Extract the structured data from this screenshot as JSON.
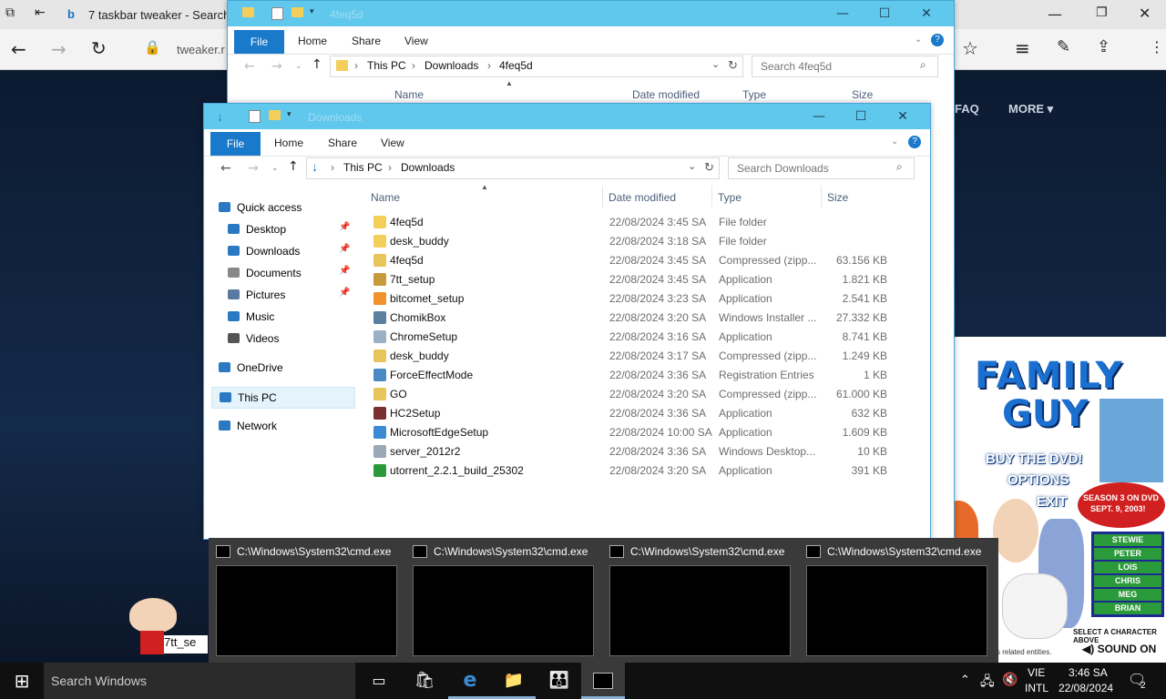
{
  "browser": {
    "tab_title": "7 taskbar tweaker - Search",
    "address": "tweaker.r",
    "site_nav": [
      "FAQ",
      "MORE ▾"
    ]
  },
  "explorer_back": {
    "title": "4feq5d",
    "ribbon_tabs": [
      "File",
      "Home",
      "Share",
      "View"
    ],
    "path": [
      "This PC",
      "Downloads",
      "4feq5d"
    ],
    "search_placeholder": "Search 4feq5d",
    "columns": [
      "Name",
      "Date modified",
      "Type",
      "Size"
    ]
  },
  "explorer_front": {
    "title": "Downloads",
    "ribbon_tabs": [
      "File",
      "Home",
      "Share",
      "View"
    ],
    "path": [
      "This PC",
      "Downloads"
    ],
    "search_placeholder": "Search Downloads",
    "columns": [
      "Name",
      "Date modified",
      "Type",
      "Size"
    ],
    "nav": [
      {
        "label": "Quick access",
        "icon": "star-icon",
        "color": "#2b79c2"
      },
      {
        "label": "Desktop",
        "icon": "desktop-icon",
        "color": "#2b79c2",
        "pinned": true
      },
      {
        "label": "Downloads",
        "icon": "download-icon",
        "color": "#2b79c2",
        "pinned": true
      },
      {
        "label": "Documents",
        "icon": "document-icon",
        "color": "#888888",
        "pinned": true
      },
      {
        "label": "Pictures",
        "icon": "picture-icon",
        "color": "#5a7aa0",
        "pinned": true
      },
      {
        "label": "Music",
        "icon": "music-icon",
        "color": "#2b79c2"
      },
      {
        "label": "Videos",
        "icon": "video-icon",
        "color": "#555555"
      },
      {
        "label": "OneDrive",
        "icon": "onedrive-icon",
        "color": "#2b79c2"
      },
      {
        "label": "This PC",
        "icon": "computer-icon",
        "color": "#2b79c2",
        "selected": true
      },
      {
        "label": "Network",
        "icon": "network-icon",
        "color": "#2b79c2"
      }
    ],
    "files": [
      {
        "name": "4feq5d",
        "date": "22/08/2024 3:45 SA",
        "type": "File folder",
        "size": "",
        "icon_color": "#f3cf5a"
      },
      {
        "name": "desk_buddy",
        "date": "22/08/2024 3:18 SA",
        "type": "File folder",
        "size": "",
        "icon_color": "#f3cf5a"
      },
      {
        "name": "4feq5d",
        "date": "22/08/2024 3:45 SA",
        "type": "Compressed (zipp...",
        "size": "63.156 KB",
        "icon_color": "#e8c45a"
      },
      {
        "name": "7tt_setup",
        "date": "22/08/2024 3:45 SA",
        "type": "Application",
        "size": "1.821 KB",
        "icon_color": "#c89a3c"
      },
      {
        "name": "bitcomet_setup",
        "date": "22/08/2024 3:23 SA",
        "type": "Application",
        "size": "2.541 KB",
        "icon_color": "#f0912a"
      },
      {
        "name": "ChomikBox",
        "date": "22/08/2024 3:20 SA",
        "type": "Windows Installer ...",
        "size": "27.332 KB",
        "icon_color": "#5b7f9e"
      },
      {
        "name": "ChromeSetup",
        "date": "22/08/2024 3:16 SA",
        "type": "Application",
        "size": "8.741 KB",
        "icon_color": "#9ab0c4"
      },
      {
        "name": "desk_buddy",
        "date": "22/08/2024 3:17 SA",
        "type": "Compressed (zipp...",
        "size": "1.249 KB",
        "icon_color": "#e8c45a"
      },
      {
        "name": "ForceEffectMode",
        "date": "22/08/2024 3:36 SA",
        "type": "Registration Entries",
        "size": "1 KB",
        "icon_color": "#4a8ac4"
      },
      {
        "name": "GO",
        "date": "22/08/2024 3:20 SA",
        "type": "Compressed (zipp...",
        "size": "61.000 KB",
        "icon_color": "#e8c45a"
      },
      {
        "name": "HC2Setup",
        "date": "22/08/2024 3:36 SA",
        "type": "Application",
        "size": "632 KB",
        "icon_color": "#7a3030"
      },
      {
        "name": "MicrosoftEdgeSetup",
        "date": "22/08/2024 10:00 SA",
        "type": "Application",
        "size": "1.609 KB",
        "icon_color": "#3a8ad4"
      },
      {
        "name": "server_2012r2",
        "date": "22/08/2024 3:36 SA",
        "type": "Windows Desktop...",
        "size": "10 KB",
        "icon_color": "#9aa8b8"
      },
      {
        "name": "utorrent_2.2.1_build_25302",
        "date": "22/08/2024 3:20 SA",
        "type": "Application",
        "size": "391 KB",
        "icon_color": "#2a9a3a"
      }
    ]
  },
  "thumbnails": [
    {
      "title": "C:\\Windows\\System32\\cmd.exe"
    },
    {
      "title": "C:\\Windows\\System32\\cmd.exe"
    },
    {
      "title": "C:\\Windows\\System32\\cmd.exe"
    },
    {
      "title": "C:\\Windows\\System32\\cmd.exe"
    }
  ],
  "desktop_label": "7tt_se",
  "ad": {
    "brand_line1": "FAMILY",
    "brand_line2": "GUY",
    "buy": "BUY THE DVD!",
    "options": "OPTIONS",
    "exit": "EXIT",
    "season_line1": "SEASON 3 ON DVD",
    "season_line2": "SEPT. 9, 2003!",
    "characters": [
      "STEWIE",
      "PETER",
      "LOIS",
      "CHRIS",
      "MEG",
      "BRIAN"
    ],
    "select_text": "SELECT A CHARACTER ABOVE",
    "sound": "SOUND ON",
    "footer": "s related entities."
  },
  "taskbar": {
    "search_placeholder": "Search Windows",
    "lang_line1": "VIE",
    "lang_line2": "INTL",
    "time": "3:46 SA",
    "date": "22/08/2024",
    "notification_count": "2"
  }
}
